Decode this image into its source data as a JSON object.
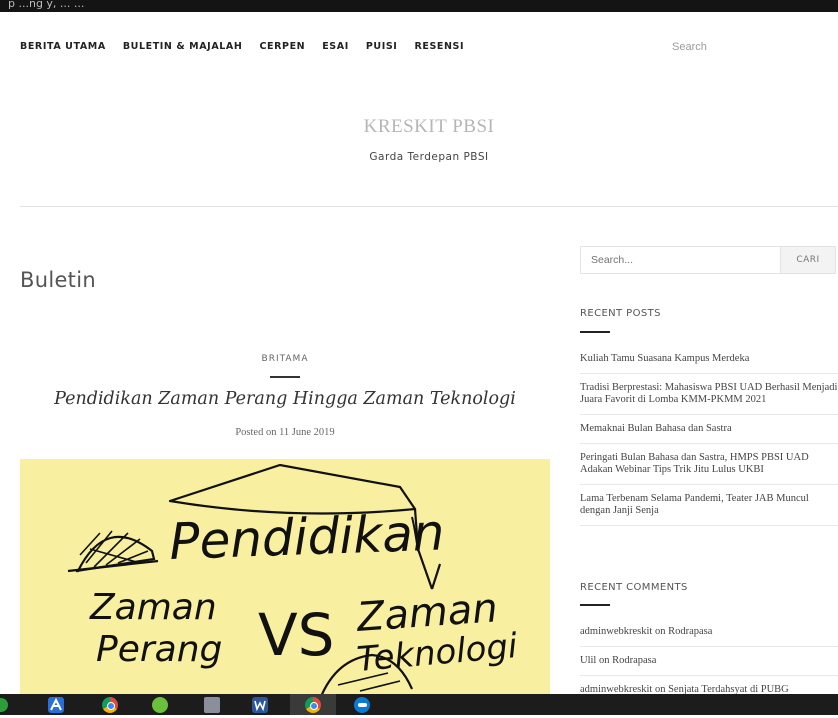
{
  "topbar": {
    "text": "p                  ...ng y, ...              ..."
  },
  "nav": {
    "items": [
      "BERITA UTAMA",
      "BULETIN & MAJALAH",
      "CERPEN",
      "ESAI",
      "PUISI",
      "RESENSI"
    ],
    "search_label": "Search"
  },
  "header": {
    "site_title": "KRESKIT PBSI",
    "tagline": "Garda Terdepan PBSI"
  },
  "main": {
    "page_heading": "Buletin",
    "post": {
      "category": "BRITAMA",
      "title": "Pendidikan Zaman Perang Hingga Zaman Teknologi",
      "meta": "Posted on 11 June 2019",
      "image_words": {
        "word1": "Pendidikan",
        "word2": "Zaman",
        "word3": "Perang",
        "word4": "VS",
        "word5": "Zaman",
        "word6": "Teknologi"
      }
    }
  },
  "sidebar": {
    "search": {
      "placeholder": "Search...",
      "button": "CARI"
    },
    "recent_posts": {
      "title": "RECENT POSTS",
      "items": [
        "Kuliah Tamu Suasana Kampus Merdeka",
        "Tradisi Berprestasi: Mahasiswa PBSI UAD Berhasil Menjadi Juara Favorit di Lomba KMM-PKMM 2021",
        "Memaknai Bulan Bahasa dan Sastra",
        "Peringati Bulan Bahasa dan Sastra, HMPS PBSI UAD Adakan Webinar Tips Trik Jitu Lulus UKBI",
        "Lama Terbenam Selama Pandemi, Teater JAB Muncul dengan Janji Senja"
      ]
    },
    "recent_comments": {
      "title": "RECENT COMMENTS",
      "items": [
        "adminwebkreskit on Rodrapasa",
        "Ulil on Rodrapasa",
        "adminwebkreskit on Senjata Terdahsyat di PUBG"
      ]
    }
  },
  "taskbar": {
    "icons": [
      "start-icon",
      "mail-icon",
      "chrome-icon",
      "sound-icon",
      "printer-icon",
      "word-icon",
      "chrome-active-icon",
      "edge-icon"
    ],
    "colors": {
      "background": "#1c1c1c",
      "chrome": "#dd4b39",
      "word": "#2b579a",
      "edge": "#0a7bd4"
    }
  }
}
